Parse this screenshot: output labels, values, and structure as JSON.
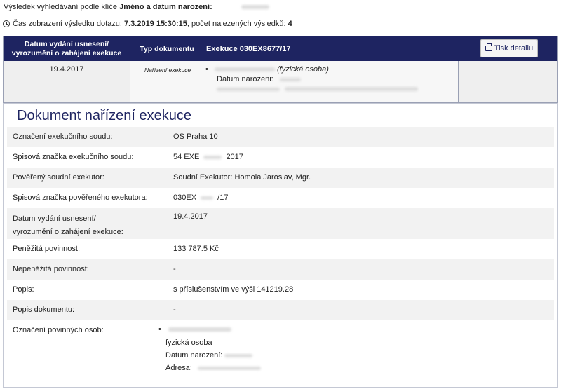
{
  "search": {
    "line_prefix": "Výsledek vyhledávání podle klíče",
    "key": "Jméno a datum narození:",
    "time_label": "Čas zobrazení výsledku dotazu:",
    "timestamp": "7.3.2019 15:30:15",
    "count_label": ", počet nalezených výsledků:",
    "count": "4"
  },
  "result_table": {
    "col1_header_line1": "Datum vydání usnesení/",
    "col1_header_line2": "vyrozumění o zahájení exekuce",
    "col2_header": "Typ dokumentu",
    "col3_header": "Exekuce 030EX8677/17",
    "print_label": "Tisk detailu",
    "row": {
      "date": "19.4.2017",
      "type": "Nařízení exekuce",
      "bullet": "•",
      "person_type": "(fyzická osoba)",
      "dob_label": "Datum narozeni:"
    }
  },
  "document": {
    "title": "Dokument nařízení exekuce",
    "fields": [
      {
        "label": "Označení exekučního soudu:",
        "value": "OS Praha 10"
      },
      {
        "label": "Spisová značka exekučního soudu:",
        "value": "54 EXE",
        "value_suffix": "2017"
      },
      {
        "label": "Pověřený soudní exekutor:",
        "value": "Soudní Exekutor: Homola Jaroslav, Mgr."
      },
      {
        "label": "Spisová značka pověřeného exekutora:",
        "value": "030EX",
        "value_suffix": "/17"
      },
      {
        "label_line1": "Datum vydání usnesení/",
        "label_line2": "vyrozumění o zahájení exekuce:",
        "value": "19.4.2017"
      },
      {
        "label": "Peněžitá povinnost:",
        "value": "133 787.5 Kč"
      },
      {
        "label": "Nepeněžitá povinnost:",
        "value": "-"
      },
      {
        "label": "Popis:",
        "value": "s příslušenstvím ve výši 141219.28"
      },
      {
        "label": "Popis dokumentu:",
        "value": "-"
      },
      {
        "label": "Označení povinných osob:",
        "bullet": "•",
        "person_type": "fyzická osoba",
        "dob_label": "Datum narození:",
        "address_label": "Adresa:"
      }
    ]
  },
  "colors": {
    "header_bg": "#1e2461",
    "title_color": "#1e2461",
    "row_shade": "#f2f2f2"
  },
  "icons": {
    "clock": "clock-icon",
    "printer": "printer-icon"
  }
}
